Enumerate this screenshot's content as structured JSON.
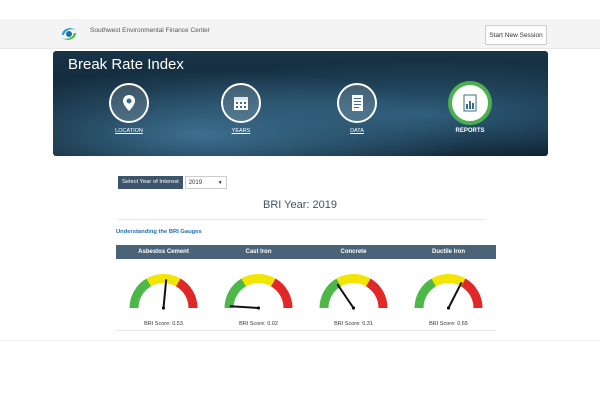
{
  "header": {
    "org_name": "Southwest Environmental Finance Center",
    "start_button": "Start New Session"
  },
  "hero": {
    "title": "Break Rate Index",
    "nav": [
      {
        "label": "LOCATION",
        "icon": "location-pin-icon"
      },
      {
        "label": "YEARS",
        "icon": "calendar-icon"
      },
      {
        "label": "DATA",
        "icon": "data-sheet-icon"
      },
      {
        "label": "REPORTS",
        "icon": "report-chart-icon"
      }
    ]
  },
  "year_selector": {
    "label": "Select Year of Interest",
    "value": "2019"
  },
  "bri_title": "BRI Year: 2019",
  "understanding_link": "Understanding the BRI Gauges",
  "gauges": [
    {
      "material": "Asbestos Cement",
      "score_text": "BRI Score: 0.53",
      "score": 0.53
    },
    {
      "material": "Cast Iron",
      "score_text": "BRI Score: 0.02",
      "score": 0.02
    },
    {
      "material": "Concrete",
      "score_text": "BRI Score: 0.31",
      "score": 0.31
    },
    {
      "material": "Ductile Iron",
      "score_text": "BRI Score: 0.65",
      "score": 0.65
    }
  ],
  "colors": {
    "gauge_green": "#4db848",
    "gauge_yellow": "#f2e600",
    "gauge_red": "#e02826",
    "header_bar": "#4a6378"
  }
}
